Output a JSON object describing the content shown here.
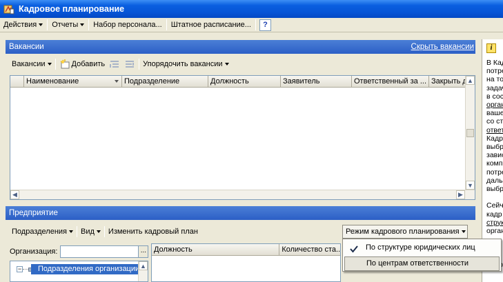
{
  "window": {
    "title": "Кадровое планирование"
  },
  "menubar": {
    "actions": "Действия",
    "reports": "Отчеты",
    "recruitment": "Набор персонала...",
    "staff_schedule": "Штатное расписание...",
    "help": "?"
  },
  "vacancies": {
    "section_title": "Вакансии",
    "hide_link": "Скрыть вакансии",
    "toolbar": {
      "vacancies_menu": "Вакансии",
      "add": "Добавить",
      "order": "Упорядочить вакансии"
    },
    "columns": [
      "Наименование",
      "Подразделение",
      "Должность",
      "Заявитель",
      "Ответственный за ...",
      "Закрыть д"
    ]
  },
  "enterprise": {
    "section_title": "Предприятие",
    "toolbar": {
      "departments": "Подразделения",
      "view": "Вид",
      "change_plan": "Изменить кадровый план",
      "mode": "Режим кадрового планирования"
    },
    "org_label": "Организация:",
    "org_value": "",
    "org_button": "...",
    "tree_item": "Подразделения организации",
    "grid2_columns": [
      "Должность",
      "Количество ста..."
    ]
  },
  "mode_menu": {
    "items": [
      {
        "label": "По структуре юридических лиц",
        "checked": true
      },
      {
        "label": "По центрам ответственности",
        "checked": false
      }
    ]
  },
  "info_panel": {
    "icon": "info-icon",
    "lines": [
      {
        "text": "В Кад",
        "link": false
      },
      {
        "text": "потре",
        "link": false
      },
      {
        "text": "на то",
        "link": false
      },
      {
        "text": "задач",
        "link": false
      },
      {
        "text": "в сос",
        "link": false
      },
      {
        "text": "орган",
        "link": true
      },
      {
        "text": "ваше",
        "link": false
      },
      {
        "text": "со ст",
        "link": false
      },
      {
        "text": "ответ",
        "link": true
      },
      {
        "text": "Кадр",
        "link": false
      },
      {
        "text": "выбр",
        "link": false
      },
      {
        "text": "завис",
        "link": false
      },
      {
        "text": "комп",
        "link": false
      },
      {
        "text": "потре",
        "link": false
      },
      {
        "text": "даль",
        "link": false
      },
      {
        "text": "выбр",
        "link": false
      },
      {
        "text": "",
        "link": false
      },
      {
        "text": "Сейч",
        "link": false
      },
      {
        "text": "кадр",
        "link": false
      },
      {
        "text": "струк",
        "link": true
      },
      {
        "text": "орган",
        "link": false
      },
      {
        "text": "",
        "link": false
      },
      {
        "text": "",
        "link": false
      },
      {
        "text": "",
        "link": false
      },
      {
        "text": "Кадр",
        "link": false
      }
    ]
  },
  "colors": {
    "titlebar": "#0654d6",
    "section_header": "#2c5fc6",
    "selection": "#316ac5"
  }
}
